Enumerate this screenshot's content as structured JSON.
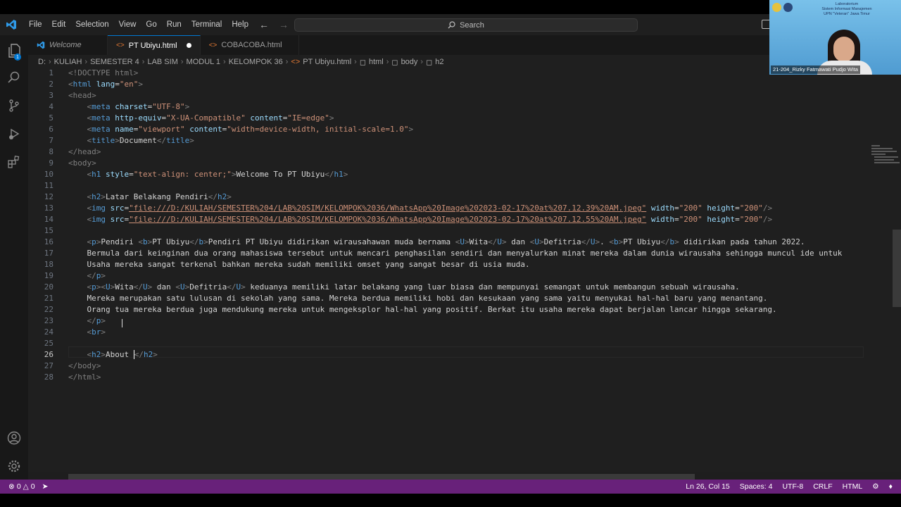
{
  "menu": [
    "File",
    "Edit",
    "Selection",
    "View",
    "Go",
    "Run",
    "Terminal",
    "Help"
  ],
  "search_label": "Search",
  "tabs": [
    {
      "label": "Welcome",
      "icon": "vscode-icon"
    },
    {
      "label": "PT Ubiyu.html",
      "icon": "html-file-icon",
      "active": true,
      "modified": true
    },
    {
      "label": "COBACOBA.html",
      "icon": "html-file-icon"
    }
  ],
  "breadcrumb": [
    "D:",
    "KULIAH",
    "SEMESTER 4",
    "LAB SIM",
    "MODUL 1",
    "KELOMPOK 36",
    "PT Ubiyu.html",
    "html",
    "body",
    "h2"
  ],
  "code": {
    "l1": "<!DOCTYPE html>",
    "l3": "<head>",
    "l8": "</head>",
    "l9": "<body>",
    "l27": "</body>",
    "l28": "</html>",
    "l5_text": "IE=edge",
    "l7_title": "Document",
    "l10_text": "Welcome To PT Ubiyu",
    "l12_text": "Latar Belakang Pendiri",
    "l13_src": "\"file:///D:/KULIAH/SEMESTER%204/LAB%20SIM/KELOMPOK%2036/WhatsApp%20Image%202023-02-17%20at%207.12.39%20AM.jpeg\"",
    "l14_src": "\"file:///D:/KULIAH/SEMESTER%204/LAB%20SIM/KELOMPOK%2036/WhatsApp%20Image%202023-02-17%20at%207.12.55%20AM.jpeg\"",
    "l17": "    Bermula dari keinginan dua orang mahasiswa tersebut untuk mencari penghasilan sendiri dan menyalurkan minat mereka dalam dunia wirausaha sehingga muncul ide untuk",
    "l18": "    Usaha mereka sangat terkenal bahkan mereka sudah memiliki omset yang sangat besar di usia muda.",
    "l21": "    Mereka merupakan satu lulusan di sekolah yang sama. Mereka berdua memiliki hobi dan kesukaan yang sama yaitu menyukai hal-hal baru yang menantang.",
    "l22": "    Orang tua mereka berdua juga mendukung mereka untuk mengeksplor hal-hal yang positif. Berkat itu usaha mereka dapat berjalan lancar hingga sekarang.",
    "l26_text": "About "
  },
  "status": {
    "errors": "0",
    "warnings": "0",
    "position": "Ln 26, Col 15",
    "spaces": "Spaces: 4",
    "encoding": "UTF-8",
    "eol": "CRLF",
    "language": "HTML"
  },
  "video": {
    "name": "21-204_Rizky Fatmawati Pudjo Wita",
    "banner": [
      "Laboratorium",
      "Sistem Informasi Manajemen",
      "UPN \"Veteran\" Jawa Timur"
    ]
  },
  "colors": {
    "status_bar": "#68217a",
    "tag": "#569cd6",
    "attr": "#9cdcfe",
    "string": "#ce9178"
  }
}
